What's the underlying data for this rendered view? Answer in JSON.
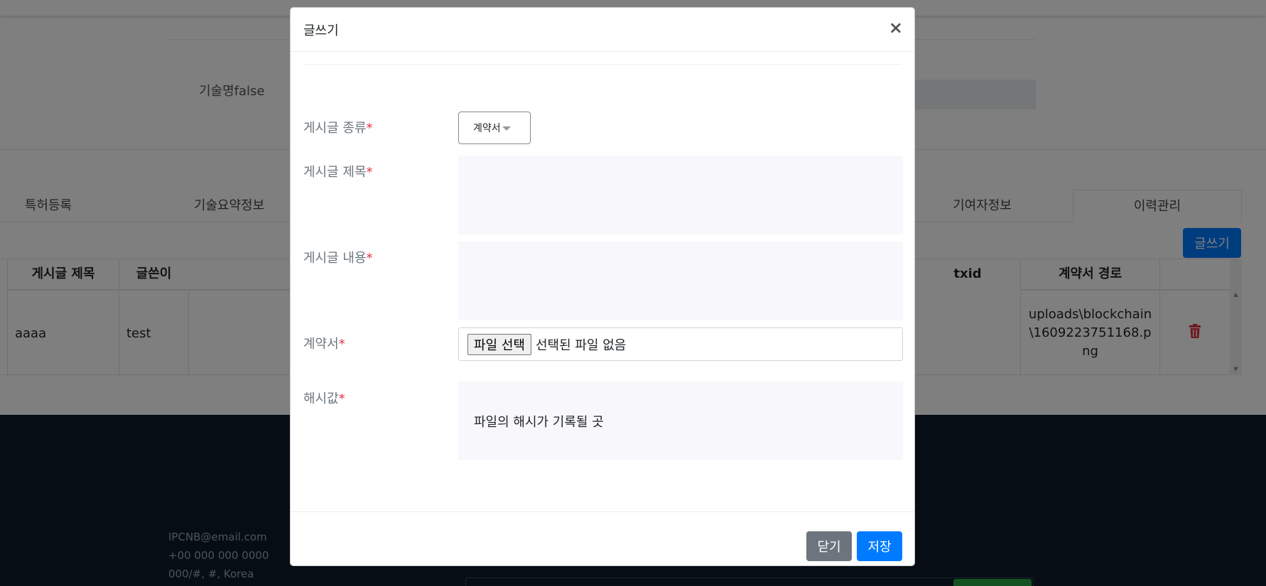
{
  "background": {
    "tech_name_label": "기술명false",
    "tabs": [
      {
        "label": "특허등록"
      },
      {
        "label": "기술요약정보"
      },
      {
        "label": "기여자정보"
      },
      {
        "label": "이력관리",
        "active": true
      }
    ],
    "write_button": "글쓰기",
    "table": {
      "headers": [
        "게시글 제목",
        "글쓴이",
        "txid",
        "계약서 경로"
      ],
      "row": {
        "title": "aaaa",
        "author": "test",
        "path": "uploads\\blockchain\\1609223751168.png"
      }
    },
    "footer": {
      "email": "IPCNB@email.com",
      "phone": "+00 000 000 0000",
      "address": "000/#, #, Korea"
    }
  },
  "modal": {
    "title": "글쓰기",
    "close_symbol": "×",
    "fields": {
      "type_label": "게시글 종류",
      "type_value": "계약서",
      "title_label": "게시글 제목",
      "content_label": "게시글 내용",
      "contract_label": "계약서",
      "file_button": "파일 선택",
      "file_status": "선택된 파일 없음",
      "hash_label": "해시값",
      "hash_placeholder": "파일의 해시가 기록될 곳"
    },
    "required_mark": "*",
    "buttons": {
      "close": "닫기",
      "save": "저장"
    }
  },
  "colors": {
    "primary": "#007bff",
    "secondary": "#6c757d",
    "required": "#dc3545",
    "footer_bg": "#0d1b2a"
  }
}
